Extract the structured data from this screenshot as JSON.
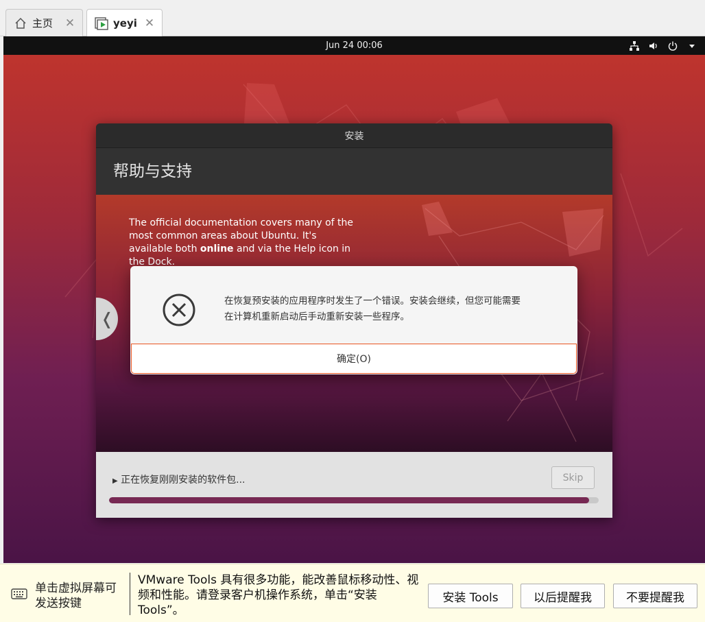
{
  "tabs": [
    {
      "label": "主页",
      "icon": "home-icon"
    },
    {
      "label": "yeyi",
      "icon": "vm-icon"
    }
  ],
  "vm": {
    "topbar": {
      "clock": "Jun 24  00:06"
    },
    "installer": {
      "window_title": "安装",
      "page_title": "帮助与支持",
      "slide": {
        "text_before": "The official documentation covers many of the most common areas about Ubuntu. It's available both ",
        "text_bold": "online",
        "text_after": " and via the Help icon in the Dock."
      },
      "status": "正在恢复刚刚安装的软件包...",
      "skip_label": "Skip",
      "progress": 0.98,
      "accent": "#772953"
    },
    "dialog": {
      "message_line1": "在恢复预安装的应用程序时发生了一个错误。安装会继续，但您可能需要",
      "message_line2": "在计算机重新启动后手动重新安装一些程序。",
      "ok_label": "确定(O)",
      "border_color": "#e95420"
    }
  },
  "toolsbar": {
    "keyboard_tip": "单击虚拟屏幕可发送按键",
    "message": "VMware Tools 具有很多功能，能改善鼠标移动性、视频和性能。请登录客户机操作系统，单击“安装 Tools”。",
    "install_label": "安装 Tools",
    "later_label": "以后提醒我",
    "never_label": "不要提醒我"
  }
}
